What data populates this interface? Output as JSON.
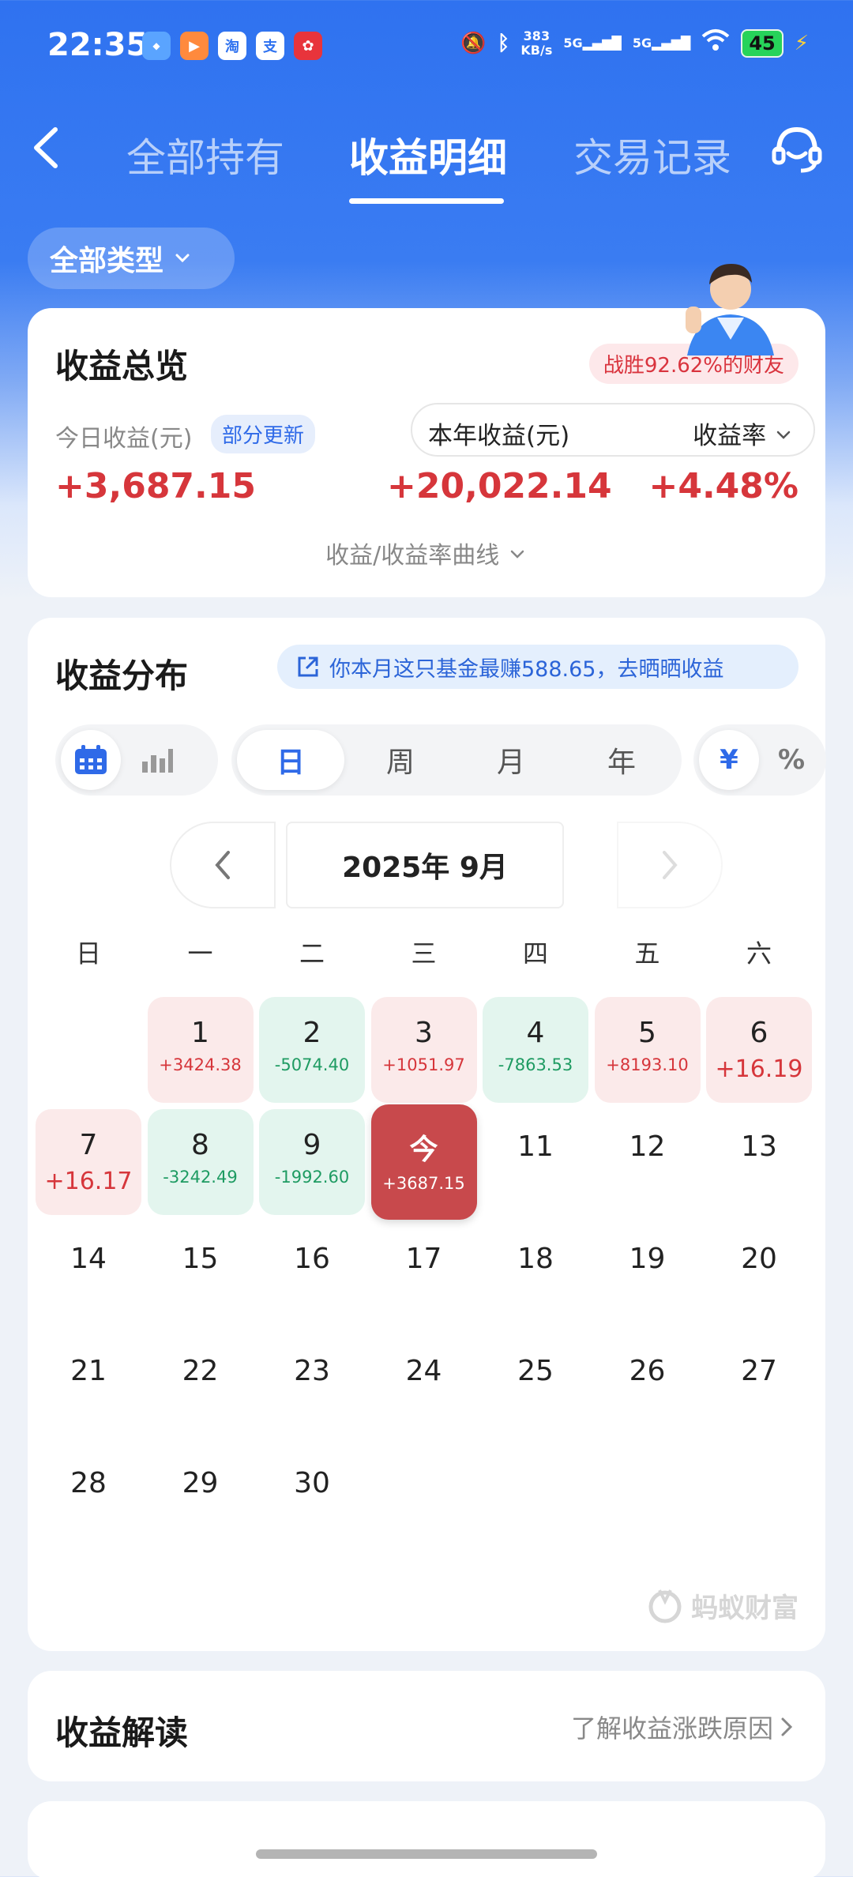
{
  "status_bar": {
    "time": "22:35",
    "net_speed_value": "383",
    "net_speed_unit": "KB/s",
    "net1": "5G",
    "net2": "5G",
    "battery": "45",
    "app_icons": [
      "uppsa-app-icon",
      "video-app-icon",
      "taobao-icon",
      "alipay-icon",
      "flower-app-icon"
    ]
  },
  "nav": {
    "tabs": [
      "全部持有",
      "收益明细",
      "交易记录"
    ],
    "active_tab": 1
  },
  "filter": {
    "type_label": "全部类型"
  },
  "overview": {
    "title": "收益总览",
    "rank_badge": "战胜92.62%的财友",
    "today_label": "今日收益(元)",
    "partial_update": "部分更新",
    "today_value": "+3,687.15",
    "year_label": "本年收益(元)",
    "rate_label": "收益率",
    "year_value": "+20,022.14",
    "rate_value": "+4.48%",
    "curve_link": "收益/收益率曲线"
  },
  "distribution": {
    "title": "收益分布",
    "share_banner": "你本月这只基金最赚588.65，去晒晒收益",
    "periods": [
      "日",
      "周",
      "月",
      "年"
    ],
    "units": [
      "¥",
      "%"
    ],
    "month_label": "2025年 9月",
    "weekdays": [
      "日",
      "一",
      "二",
      "三",
      "四",
      "五",
      "六"
    ],
    "days": [
      {
        "n": "1",
        "amt": "+3424.38",
        "kind": "gain"
      },
      {
        "n": "2",
        "amt": "-5074.40",
        "kind": "loss"
      },
      {
        "n": "3",
        "amt": "+1051.97",
        "kind": "gain"
      },
      {
        "n": "4",
        "amt": "-7863.53",
        "kind": "loss"
      },
      {
        "n": "5",
        "amt": "+8193.10",
        "kind": "gain"
      },
      {
        "n": "6",
        "amt": "+16.19",
        "kind": "gain"
      },
      {
        "n": "7",
        "amt": "+16.17",
        "kind": "gain"
      },
      {
        "n": "8",
        "amt": "-3242.49",
        "kind": "loss"
      },
      {
        "n": "9",
        "amt": "-1992.60",
        "kind": "loss"
      },
      {
        "n": "今",
        "amt": "+3687.15",
        "kind": "today"
      },
      {
        "n": "11"
      },
      {
        "n": "12"
      },
      {
        "n": "13"
      },
      {
        "n": "14"
      },
      {
        "n": "15"
      },
      {
        "n": "16"
      },
      {
        "n": "17"
      },
      {
        "n": "18"
      },
      {
        "n": "19"
      },
      {
        "n": "20"
      },
      {
        "n": "21"
      },
      {
        "n": "22"
      },
      {
        "n": "23"
      },
      {
        "n": "24"
      },
      {
        "n": "25"
      },
      {
        "n": "26"
      },
      {
        "n": "27"
      },
      {
        "n": "28"
      },
      {
        "n": "29"
      },
      {
        "n": "30"
      }
    ],
    "watermark": "蚂蚁财富"
  },
  "interpret": {
    "title": "收益解读",
    "link": "了解收益涨跌原因"
  },
  "colors": {
    "brand_blue": "#2f72f0",
    "gain_red": "#d6363b",
    "loss_green": "#1e9b62",
    "today_red": "#c8494c"
  }
}
